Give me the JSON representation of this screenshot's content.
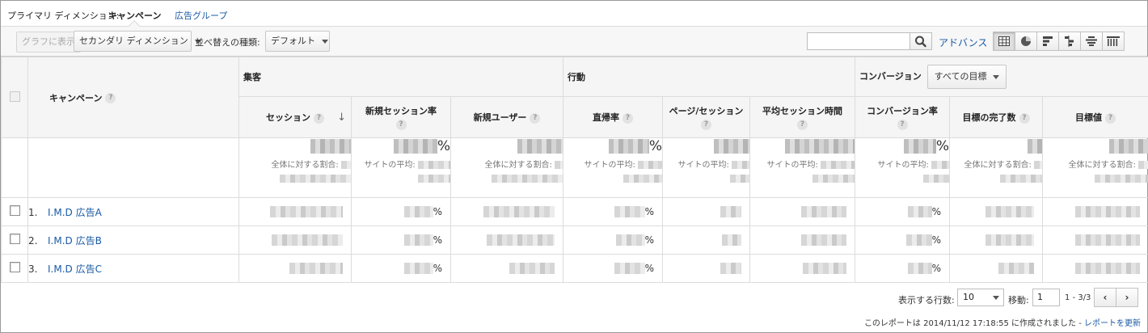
{
  "dimension_bar": {
    "label": "プライマリ ディメンション:",
    "selected": "キャンペーン",
    "link": "広告グループ"
  },
  "toolbar": {
    "graph_button": "グラフに表示",
    "secondary_dimension": "セカンダリ ディメンション",
    "sort_label": "並べ替えの種類:",
    "sort_value": "デフォルト",
    "search_placeholder": "",
    "advanced_link": "アドバンス",
    "view_icons": [
      "table-view-icon",
      "pie-view-icon",
      "performance-view-icon",
      "comparison-view-icon",
      "term-cloud-view-icon",
      "pivot-view-icon"
    ]
  },
  "table": {
    "dimension_header": "キャンペーン",
    "groups": {
      "acquisition": "集客",
      "behavior": "行動",
      "conversion": "コンバージョン",
      "goal_select": "すべての目標"
    },
    "columns": [
      "セッション",
      "新規セッション率",
      "新規ユーザー",
      "直帰率",
      "ページ/セッション",
      "平均セッション時間",
      "コンバージョン率",
      "目標の完了数",
      "目標値"
    ],
    "totals": {
      "percent_sign": "%",
      "share_of_total": "全体に対する割合:",
      "site_average": "サイトの平均:"
    },
    "rows": [
      {
        "index": "1.",
        "name": "I.M.D 広告A",
        "percent": "%"
      },
      {
        "index": "2.",
        "name": "I.M.D 広告B",
        "percent": "%"
      },
      {
        "index": "3.",
        "name": "I.M.D 広告C",
        "percent": "%"
      }
    ]
  },
  "footer": {
    "rows_label": "表示する行数:",
    "rows_value": "10",
    "goto_label": "移動:",
    "goto_value": "1",
    "range": "1 - 3/3",
    "prev": "‹",
    "next": "›",
    "report_text": "このレポートは 2014/11/12 17:18:55 に作成されました -",
    "refresh_link": "レポートを更新"
  },
  "colors": {
    "link": "#1a5aa6",
    "header_bg": "#f5f5f5",
    "toolbar_bg": "#f7f7f7"
  }
}
